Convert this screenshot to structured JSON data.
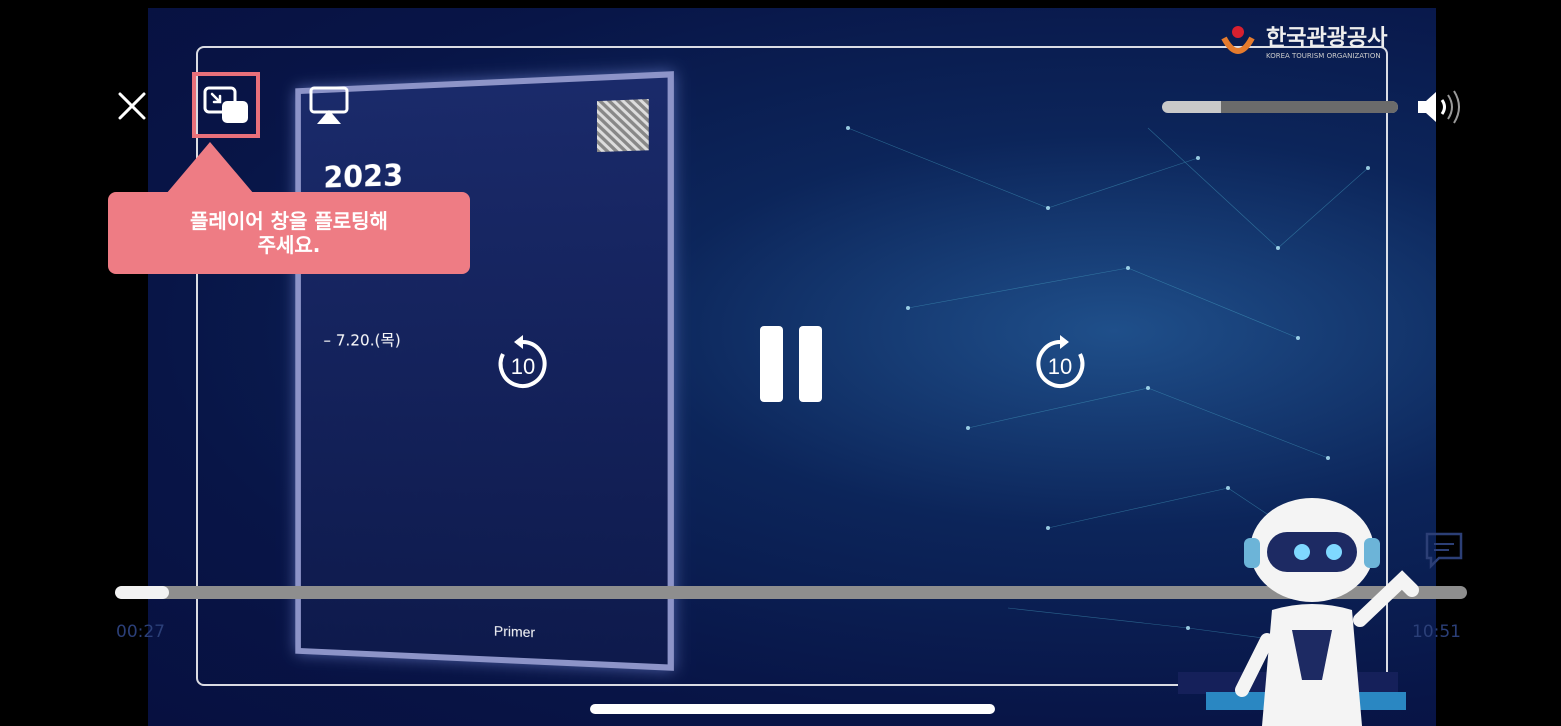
{
  "video": {
    "poster_year": "2023",
    "poster_date": "– 7.20.(목)",
    "poster_brand": "Primer",
    "logo_text": "한국관광공사",
    "logo_sub": "KOREA TOURISM ORGANIZATION"
  },
  "controls": {
    "close_icon": "close-icon",
    "pip_icon": "picture-in-picture-icon",
    "airplay_icon": "airplay-icon",
    "volume_level": 0.25,
    "speaker_icon": "speaker-icon",
    "skip_back_label": "10",
    "skip_forward_label": "10",
    "pause_icon": "pause-icon",
    "speed_icon": "playback-speed-icon",
    "subtitles_icon": "subtitles-icon"
  },
  "tooltip": {
    "line1": "플레이어 창을 플로팅해",
    "line2": "주세요."
  },
  "timeline": {
    "elapsed": "00:27",
    "remaining": "10:51",
    "progress": 0.04
  },
  "colors": {
    "highlight": "#e8707a",
    "tooltip_bg": "#ee7c84"
  }
}
